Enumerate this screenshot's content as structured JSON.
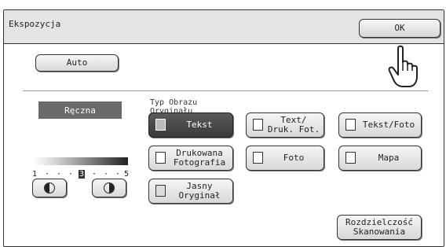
{
  "window": {
    "title": "Ekspozycja"
  },
  "buttons": {
    "ok": "OK",
    "auto": "Auto",
    "resolution": "Rozdzielczość\nSkanowania"
  },
  "exposure": {
    "manual_label": "Ręczna",
    "scale": [
      "1",
      "·",
      "·",
      "·",
      "3",
      "·",
      "·",
      "·",
      "5"
    ],
    "current_level": 3,
    "lighter_icon": "lighter-icon",
    "darker_icon": "darker-icon"
  },
  "original_type": {
    "label": "Typ Obrazu\nOryginału",
    "options": [
      {
        "label": "Tekst",
        "icon": "text-doc-icon",
        "selected": true
      },
      {
        "label": "Text/\nDruk. Fot.",
        "icon": "text-printed-photo-icon",
        "selected": false
      },
      {
        "label": "Tekst/Foto",
        "icon": "text-photo-icon",
        "selected": false
      },
      {
        "label": "Drukowana\nFotografia",
        "icon": "printed-photo-icon",
        "selected": false
      },
      {
        "label": "Foto",
        "icon": "photo-icon",
        "selected": false
      },
      {
        "label": "Mapa",
        "icon": "map-icon",
        "selected": false
      },
      {
        "label": "Jasny\nOryginał",
        "icon": "light-original-icon",
        "selected": false
      }
    ]
  },
  "pointer_icon": "hand-pointer-icon"
}
